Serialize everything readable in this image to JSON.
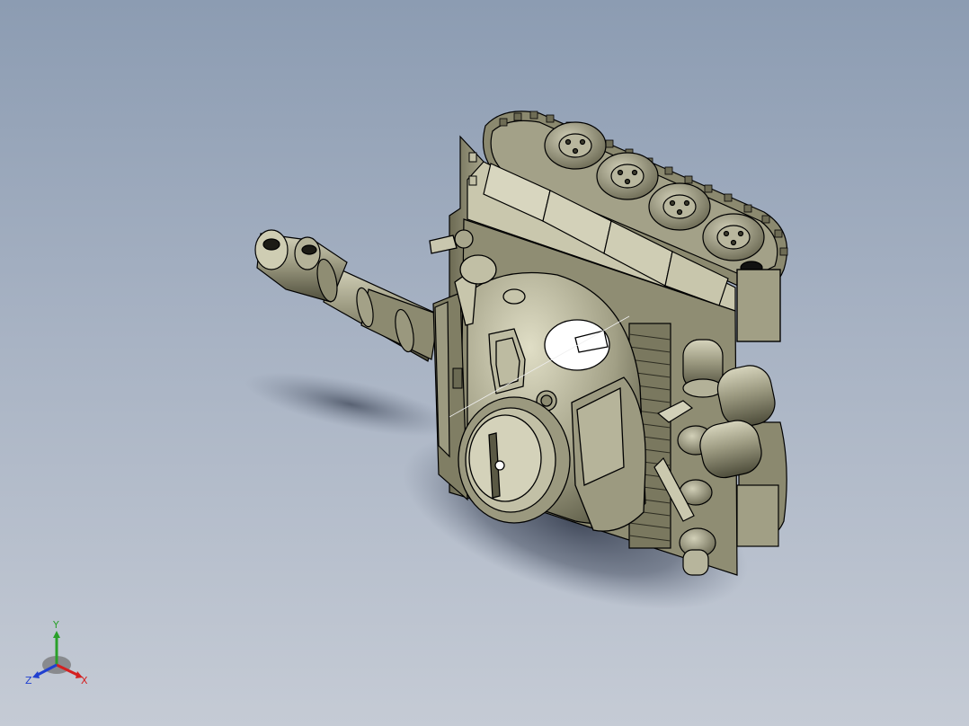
{
  "viewport": {
    "background_top": "#8c9cb2",
    "background_bottom": "#c5cbd5"
  },
  "model": {
    "body_color": "#7d7b62",
    "highlight_color": "#cfcdb3",
    "edge_color": "#000000"
  },
  "triad": {
    "x_label": "X",
    "y_label": "Y",
    "z_label": "Z",
    "x_color": "#d42020",
    "y_color": "#2aa02a",
    "z_color": "#2040d0"
  }
}
